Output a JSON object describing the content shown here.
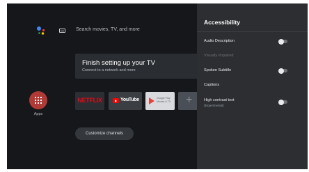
{
  "home": {
    "search_placeholder": "Search movies, TV, and more",
    "setup_title": "Finish setting up your TV",
    "setup_subtitle": "Connect to a network and more",
    "apps_label": "Apps",
    "tiles": {
      "netflix": "NETFLIX",
      "youtube": "YouTube",
      "play_line1": "Google Play",
      "play_line2": "Movies & TV",
      "add": "+"
    },
    "customize_label": "Customize channels"
  },
  "panel": {
    "title": "Accessibility",
    "items": [
      {
        "label": "Audio Description",
        "toggle": "off"
      },
      {
        "label": "Visually Impaired",
        "disabled": true
      },
      {
        "label": "Spoken Subtitle",
        "toggle": "off"
      },
      {
        "label": "Captions"
      },
      {
        "label": "High contrast text",
        "sub": "(Experimental)",
        "toggle": "off"
      }
    ]
  },
  "colors": {
    "background": "#15171a",
    "panel": "#2c2e31",
    "apps_button": "#b23a36",
    "netflix_red": "#e50914"
  },
  "icons": [
    "google-assistant-icon",
    "keyboard-icon",
    "apps-grid-icon",
    "youtube-icon",
    "google-play-icon",
    "plus-icon"
  ]
}
